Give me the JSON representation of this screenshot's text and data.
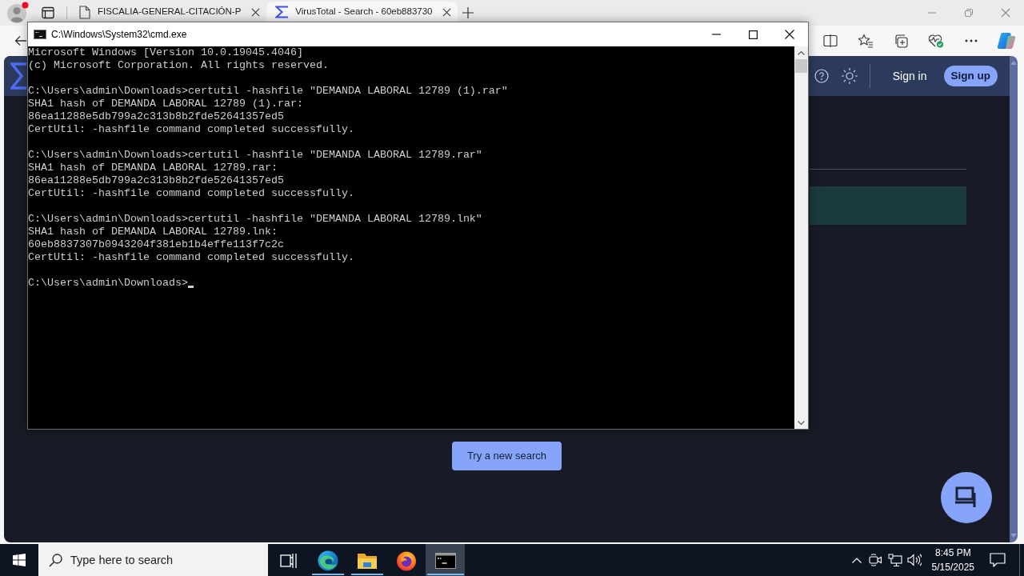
{
  "browser": {
    "tabs": [
      {
        "kind": "document",
        "title": "FISCALIA-GENERAL-CITACIÓN-P",
        "selected": false
      },
      {
        "kind": "virustotal",
        "title": "VirusTotal - Search - 60eb883730",
        "selected": true
      }
    ]
  },
  "page": {
    "header": {
      "sign_in": "Sign in",
      "sign_up": "Sign up"
    },
    "search_again_button": "Try a new search"
  },
  "cmd_window": {
    "title": "C:\\Windows\\System32\\cmd.exe",
    "blocks": [
      [
        "Microsoft Windows [Version 10.0.19045.4046]",
        "(c) Microsoft Corporation. All rights reserved."
      ],
      [
        "C:\\Users\\admin\\Downloads>certutil -hashfile \"DEMANDA LABORAL 12789 (1).rar\"",
        "SHA1 hash of DEMANDA LABORAL 12789 (1).rar:",
        "86ea11288e5db799a2c313b8b2fde52641357ed5",
        "CertUtil: -hashfile command completed successfully."
      ],
      [
        "C:\\Users\\admin\\Downloads>certutil -hashfile \"DEMANDA LABORAL 12789.rar\"",
        "SHA1 hash of DEMANDA LABORAL 12789.rar:",
        "86ea11288e5db799a2c313b8b2fde52641357ed5",
        "CertUtil: -hashfile command completed successfully."
      ],
      [
        "C:\\Users\\admin\\Downloads>certutil -hashfile \"DEMANDA LABORAL 12789.lnk\"",
        "SHA1 hash of DEMANDA LABORAL 12789.lnk:",
        "60eb8837307b0943204f381eb1b4effe113f7c2c",
        "CertUtil: -hashfile command completed successfully."
      ]
    ],
    "prompt": "C:\\Users\\admin\\Downloads>"
  },
  "taskbar": {
    "search_placeholder": "Type here to search",
    "apps": [
      {
        "kind": "task-view",
        "running": false,
        "selected": false
      },
      {
        "kind": "edge",
        "running": true,
        "selected": false
      },
      {
        "kind": "explorer",
        "running": true,
        "selected": false
      },
      {
        "kind": "firefox",
        "running": false,
        "selected": false
      },
      {
        "kind": "terminal",
        "running": true,
        "selected": true
      }
    ],
    "clock": {
      "time": "8:45 PM",
      "date": "5/15/2025"
    }
  }
}
